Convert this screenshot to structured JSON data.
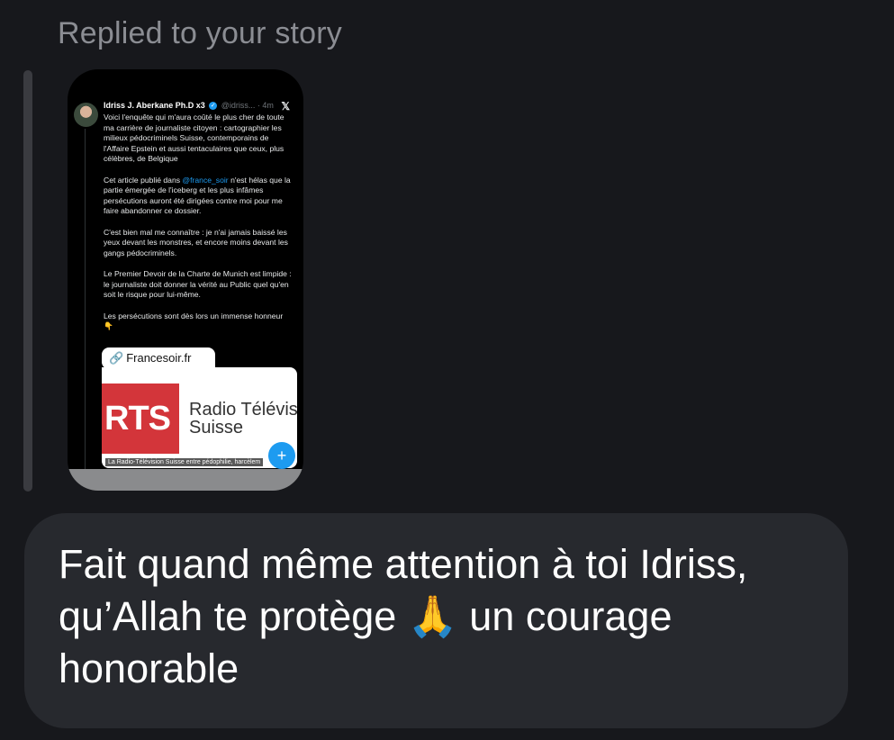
{
  "reply": {
    "label": "Replied to your story"
  },
  "story": {
    "tweet": {
      "author_name": "Idriss J. Aberkane Ph.D x3",
      "verified_icon": "✓",
      "handle_time": "@idriss... · 4m",
      "platform_icon": "𝕏",
      "paragraphs": [
        "Voici l'enquête qui m'aura coûté le plus cher de toute ma carrière de journaliste citoyen : cartographier les milieux pédocriminels Suisse, contemporains de l'Affaire Epstein et aussi tentaculaires que ceux, plus célèbres, de Belgique",
        "Cet article publié dans",
        "@france_soir",
        "n'est hélas que la partie émergée de l'iceberg et les plus infâmes persécutions auront été dirigées contre moi pour me faire abandonner ce dossier.",
        "C'est bien mal me connaître : je n'ai jamais baissé les yeux devant les monstres, et encore moins devant les gangs pédocriminels.",
        "Le Premier Devoir de la Charte de Munich est limpide : le journaliste doit donner la vérité au Public quel qu'en soit le risque pour lui-même.",
        "Les persécutions sont dès lors un immense honneur 👇"
      ]
    },
    "link_chip": {
      "icon": "🔗",
      "label": "Francesoir.fr"
    },
    "card": {
      "logo_text": "RTS",
      "name_line1": "Radio Télévis",
      "name_line2": "Suisse",
      "caption": "La Radio-Télévision Suisse entre pédophilie, harcèlem",
      "fab_icon": "+"
    }
  },
  "message": {
    "text": "Fait quand même attention à toi Idriss, qu’Allah te protège 🙏 un courage honorable"
  }
}
